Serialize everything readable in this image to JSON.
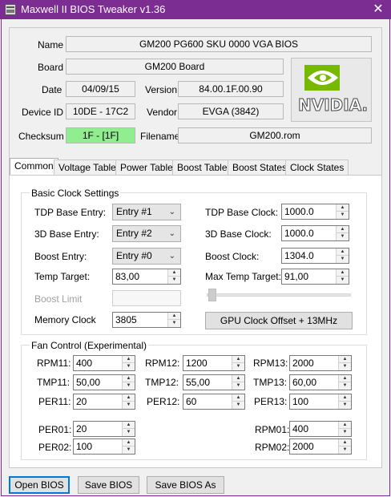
{
  "window": {
    "title": "Maxwell II BIOS Tweaker v1.36",
    "close_glyph": "✕"
  },
  "info": {
    "name_label": "Name",
    "name_value": "GM200 PG600 SKU 0000 VGA BIOS",
    "board_label": "Board",
    "board_value": "GM200 Board",
    "date_label": "Date",
    "date_value": "04/09/15",
    "version_label": "Version",
    "version_value": "84.00.1F.00.90",
    "device_label": "Device ID",
    "device_value": "10DE - 17C2",
    "vendor_label": "Vendor",
    "vendor_value": "EVGA (3842)",
    "checksum_label": "Checksum",
    "checksum_value": "1F - [1F]",
    "filename_label": "Filename",
    "filename_value": "GM200.rom",
    "logo_text": "NVIDIA.",
    "checksum_color": "#90ee90"
  },
  "tabs": [
    {
      "label": "Common",
      "active": true
    },
    {
      "label": "Voltage Table"
    },
    {
      "label": "Power Table"
    },
    {
      "label": "Boost Table"
    },
    {
      "label": "Boost States"
    },
    {
      "label": "Clock States"
    }
  ],
  "clock": {
    "group_title": "Basic Clock Settings",
    "tdp_entry_label": "TDP Base Entry:",
    "tdp_entry_value": "Entry #1",
    "base3d_entry_label": "3D Base Entry:",
    "base3d_entry_value": "Entry #2",
    "boost_entry_label": "Boost Entry:",
    "boost_entry_value": "Entry #0",
    "temp_target_label": "Temp Target:",
    "temp_target_value": "83,00",
    "boost_limit_label": "Boost Limit",
    "boost_limit_value": "",
    "memory_clock_label": "Memory Clock",
    "memory_clock_value": "3805",
    "tdp_clock_label": "TDP Base Clock:",
    "tdp_clock_value": "1000.0",
    "base3d_clock_label": "3D Base Clock:",
    "base3d_clock_value": "1000.0",
    "boost_clock_label": "Boost Clock:",
    "boost_clock_value": "1304.0",
    "max_temp_label": "Max Temp Target:",
    "max_temp_value": "91,00",
    "offset_button": "GPU Clock Offset + 13MHz",
    "slider_level": 0
  },
  "fan": {
    "group_title": "Fan Control (Experimental)",
    "rows": [
      [
        {
          "label": "RPM11:",
          "value": "400"
        },
        {
          "label": "RPM12:",
          "value": "1200"
        },
        {
          "label": "RPM13:",
          "value": "2000"
        }
      ],
      [
        {
          "label": "TMP11:",
          "value": "50,00"
        },
        {
          "label": "TMP12:",
          "value": "55,00"
        },
        {
          "label": "TMP13:",
          "value": "60,00"
        }
      ],
      [
        {
          "label": "PER11:",
          "value": "20"
        },
        {
          "label": "PER12:",
          "value": "60"
        },
        {
          "label": "PER13:",
          "value": "100"
        }
      ]
    ],
    "per01_label": "PER01:",
    "per01_value": "20",
    "per02_label": "PER02:",
    "per02_value": "100",
    "rpm01_label": "RPM01:",
    "rpm01_value": "400",
    "rpm02_label": "RPM02:",
    "rpm02_value": "2000"
  },
  "buttons": {
    "open": "Open BIOS",
    "save": "Save BIOS",
    "save_as": "Save BIOS As"
  },
  "icons": {
    "spin_up": "▲",
    "spin_down": "▼",
    "combo_arrow": "⌄"
  }
}
